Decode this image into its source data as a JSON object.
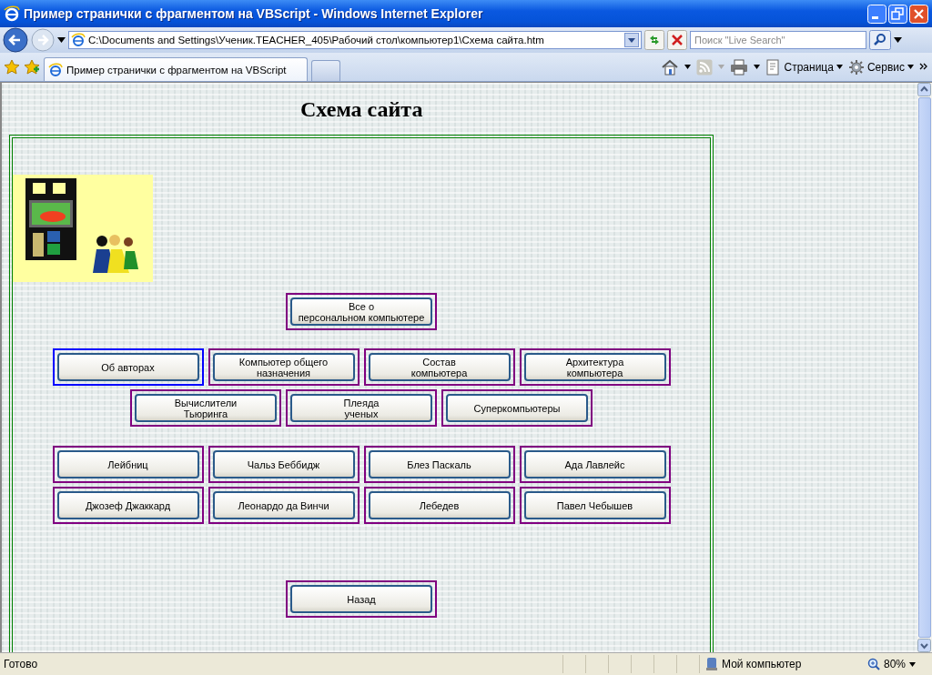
{
  "window": {
    "title": "Пример странички с фрагментом на VBScript - Windows Internet Explorer"
  },
  "address_bar": {
    "value": "C:\\Documents and Settings\\Ученик.TEACHER_405\\Рабочий стол\\компьютер1\\Схема сайта.htm"
  },
  "search": {
    "placeholder": "Поиск \"Live Search\""
  },
  "tabs": [
    {
      "label": "Пример странички с фрагментом на VBScript",
      "selected": true
    }
  ],
  "command_bar": [
    {
      "label": "Страница"
    },
    {
      "label": "Сервис"
    }
  ],
  "page": {
    "heading": "Схема сайта",
    "picture": {
      "kind": "picture"
    },
    "rows": [
      [
        {
          "label": "Все о\nперсональном компьютере",
          "color": "#800080"
        }
      ],
      [
        {
          "label": "Об авторах",
          "color": "#0000ff"
        },
        {
          "label": "Компьютер общего\nназначения",
          "color": "#800080"
        },
        {
          "label": "Состав\nкомпьютера",
          "color": "#800080"
        },
        {
          "label": "Архитектура\nкомпьютера",
          "color": "#800080"
        }
      ],
      [
        {
          "label": "Вычислители\nТьюринга",
          "color": "#800080"
        },
        {
          "label": "Плеяда\nученых",
          "color": "#800080"
        },
        {
          "label": "Суперкомпьютеры",
          "color": "#800080"
        }
      ],
      [
        {
          "label": "Лейбниц",
          "color": "#800080"
        },
        {
          "label": "Чальз Беббидж",
          "color": "#800080"
        },
        {
          "label": "Блез Паскаль",
          "color": "#800080"
        },
        {
          "label": "Ада Лавлейс",
          "color": "#800080"
        }
      ],
      [
        {
          "label": "Джозеф Джаккард",
          "color": "#800080"
        },
        {
          "label": "Леонардо да Винчи",
          "color": "#800080"
        },
        {
          "label": "Лебедев",
          "color": "#800080"
        },
        {
          "label": "Павел Чебышев",
          "color": "#800080"
        }
      ]
    ],
    "back_button": {
      "label": "Назад",
      "color": "#800080"
    }
  },
  "status_bar": {
    "status": "Готово",
    "zone": "Мой компьютер",
    "zoom": "80%"
  }
}
